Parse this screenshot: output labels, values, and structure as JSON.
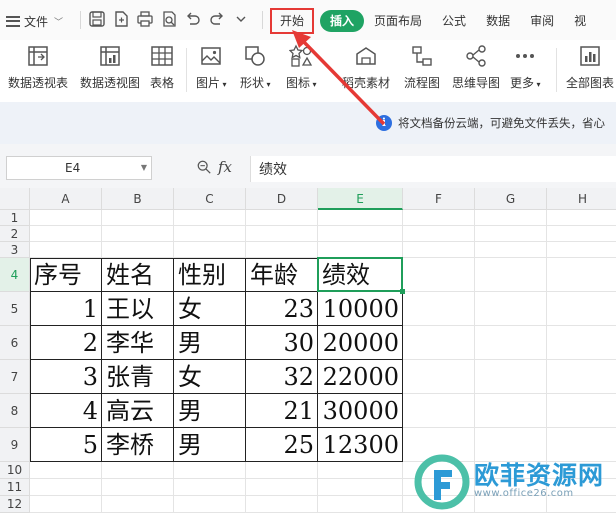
{
  "menubar": {
    "file_label": "文件",
    "tabs": [
      "开始",
      "插入",
      "页面布局",
      "公式",
      "数据",
      "审阅",
      "视"
    ]
  },
  "ribbon": {
    "items": [
      {
        "label": "数据透视表",
        "icon": "pivot-table-icon"
      },
      {
        "label": "数据透视图",
        "icon": "pivot-chart-icon"
      },
      {
        "label": "表格",
        "icon": "table-icon"
      },
      {
        "label": "图片",
        "icon": "picture-icon"
      },
      {
        "label": "形状",
        "icon": "shape-icon"
      },
      {
        "label": "图标",
        "icon": "icons-library-icon"
      },
      {
        "label": "稻壳素材",
        "icon": "docer-material-icon"
      },
      {
        "label": "流程图",
        "icon": "flowchart-icon"
      },
      {
        "label": "思维导图",
        "icon": "mindmap-icon"
      },
      {
        "label": "更多",
        "icon": "more-icon"
      },
      {
        "label": "全部图表",
        "icon": "all-charts-icon"
      }
    ]
  },
  "notice": {
    "icon": "info-icon",
    "text": "将文档备份云端，可避免文件丢失，省心"
  },
  "formula_bar": {
    "cell_ref": "E4",
    "fx_label": "fx",
    "content": "绩效"
  },
  "sheet": {
    "columns": [
      "A",
      "B",
      "C",
      "D",
      "E",
      "F",
      "G",
      "H"
    ],
    "rows": [
      "1",
      "2",
      "3",
      "4",
      "5",
      "6",
      "7",
      "8",
      "9",
      "10",
      "11",
      "12"
    ],
    "selected_col": "E",
    "selected_row": "4",
    "table": {
      "headers": [
        "序号",
        "姓名",
        "性别",
        "年龄",
        "绩效"
      ],
      "rows": [
        [
          "1",
          "王以",
          "女",
          "23",
          "10000"
        ],
        [
          "2",
          "李华",
          "男",
          "30",
          "20000"
        ],
        [
          "3",
          "张青",
          "女",
          "32",
          "22000"
        ],
        [
          "4",
          "高云",
          "男",
          "21",
          "30000"
        ],
        [
          "5",
          "李桥",
          "男",
          "25",
          "12300"
        ]
      ]
    }
  },
  "watermark": {
    "title": "欧菲资源网",
    "url": "www.office26.com"
  },
  "colors": {
    "accent_green": "#1f9e5a",
    "insert_tab_bg": "#1fa363",
    "annotation_red": "#e53935",
    "info_blue": "#2d6fe0",
    "watermark_blue": "#2c9ad6"
  }
}
